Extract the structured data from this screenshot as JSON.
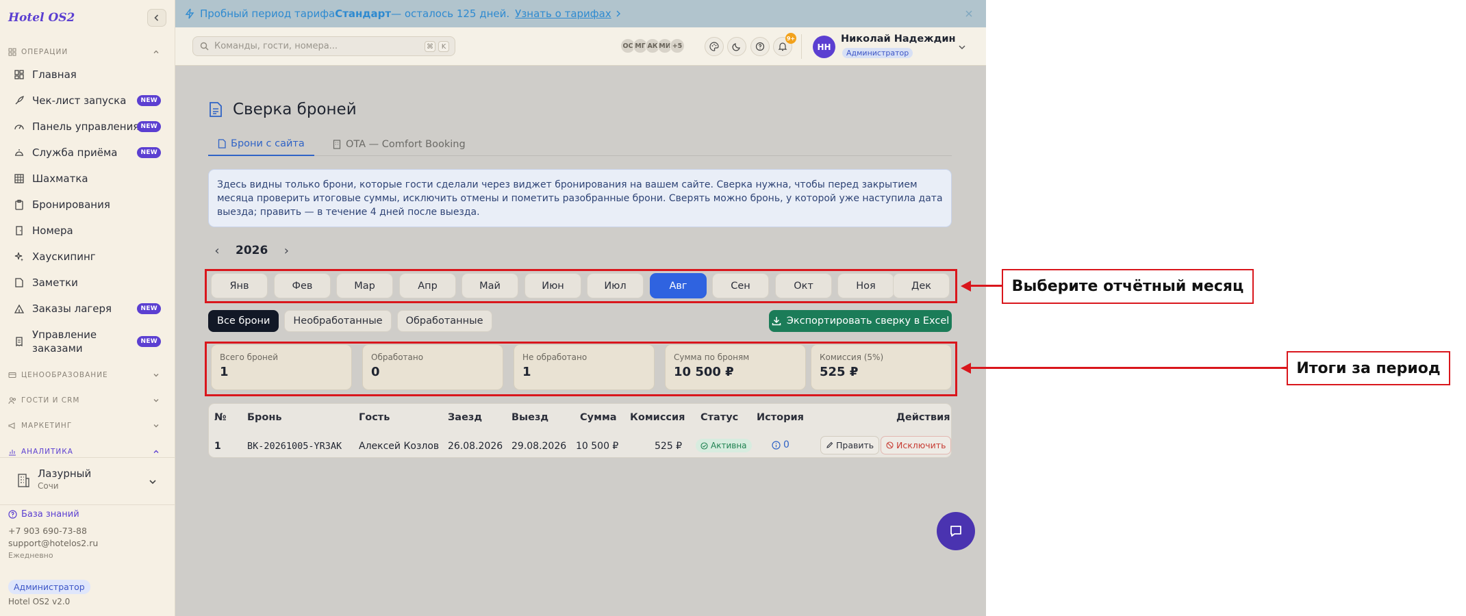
{
  "app": {
    "brand": "Hotel OS2",
    "version": "Hotel OS2 v2.0"
  },
  "sidebar": {
    "sections": {
      "operations": "ОПЕРАЦИИ",
      "pricing": "ЦЕНООБРАЗОВАНИЕ",
      "guests": "ГОСТИ И CRM",
      "marketing": "МАРКЕТИНГ",
      "analytics": "АНАЛИТИКА"
    },
    "items": [
      {
        "label": "Главная",
        "badge": ""
      },
      {
        "label": "Чек-лист запуска",
        "badge": "NEW"
      },
      {
        "label": "Панель управления",
        "badge": "NEW"
      },
      {
        "label": "Служба приёма",
        "badge": "NEW"
      },
      {
        "label": "Шахматка",
        "badge": ""
      },
      {
        "label": "Бронирования",
        "badge": ""
      },
      {
        "label": "Номера",
        "badge": ""
      },
      {
        "label": "Хаускипинг",
        "badge": ""
      },
      {
        "label": "Заметки",
        "badge": ""
      },
      {
        "label": "Заказы лагеря",
        "badge": "NEW"
      },
      {
        "label": "Управление",
        "label2": "заказами",
        "badge": "NEW"
      }
    ],
    "hotel": {
      "name": "Лазурный",
      "city": "Сочи"
    },
    "help": {
      "kb": "База знаний",
      "phone": "+7 903 690-73-88",
      "email": "support@hotelos2.ru",
      "hours": "Ежедневно"
    },
    "role": "Администратор"
  },
  "banner": {
    "prefix": "Пробный период тарифа ",
    "plan": "Стандарт",
    "suffix": " — осталось 125 дней.",
    "link": "Узнать о тарифах"
  },
  "topbar": {
    "search_placeholder": "Команды, гости, номера...",
    "kbd1": "⌘",
    "kbd2": "K",
    "online": [
      "ОС",
      "МГ",
      "АК",
      "МИ",
      "+5"
    ],
    "notif_count": "9+",
    "user": {
      "initials": "НН",
      "name": "Николай Надеждин",
      "role": "Администратор"
    }
  },
  "page": {
    "title": "Сверка броней",
    "tabs": [
      "Брони с сайта",
      "OTA — Comfort Booking"
    ],
    "info": "Здесь видны только брони, которые гости сделали через виджет бронирования на вашем сайте. Сверка нужна, чтобы перед закрытием месяца проверить итоговые суммы, исключить отмены и пометить разобранные брони. Сверять можно бронь, у которой уже наступила дата выезда; править — в течение 4 дней после выезда.",
    "year": "2026",
    "months": [
      "Янв",
      "Фев",
      "Мар",
      "Апр",
      "Май",
      "Июн",
      "Июл",
      "Авг",
      "Сен",
      "Окт",
      "Ноя",
      "Дек"
    ],
    "active_month": "Авг",
    "filters": [
      "Все брони",
      "Необработанные",
      "Обработанные"
    ],
    "export_label": "Экспортировать сверку в Excel",
    "kpis": [
      {
        "label": "Всего броней",
        "value": "1"
      },
      {
        "label": "Обработано",
        "value": "0"
      },
      {
        "label": "Не обработано",
        "value": "1"
      },
      {
        "label": "Сумма по броням",
        "value": "10 500 ₽"
      },
      {
        "label": "Комиссия (5%)",
        "value": "525 ₽"
      }
    ],
    "table": {
      "headers": [
        "№",
        "Бронь",
        "Гость",
        "Заезд",
        "Выезд",
        "Сумма",
        "Комиссия",
        "Статус",
        "История",
        "Действия"
      ],
      "rows": [
        {
          "num": "1",
          "booking": "BK-20261005-YR3AK",
          "guest": "Алексей Козлов",
          "checkin": "26.08.2026",
          "checkout": "29.08.2026",
          "amount": "10 500 ₽",
          "commission": "525 ₽",
          "status": "Активна",
          "history": "0",
          "edit": "Править",
          "exclude": "Исключить"
        }
      ]
    }
  },
  "annotations": {
    "month": "Выберите отчётный месяц",
    "totals": "Итоги за период"
  },
  "colors": {
    "accent": "#5b3fd1",
    "primary_blue": "#2f63e0",
    "export_green": "#1b7c58",
    "annotation_red": "#d9161c"
  }
}
